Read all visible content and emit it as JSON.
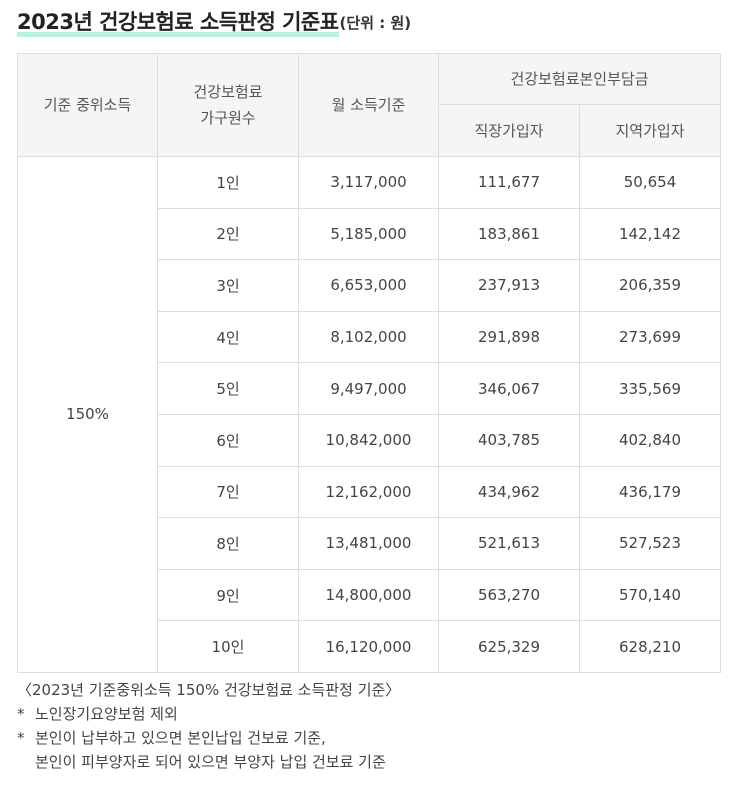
{
  "title": {
    "main": "2023년 건강보험료 소득판정 기준표",
    "unit": "(단위 : 원)"
  },
  "table": {
    "headers": {
      "median_income": "기준 중위소득",
      "household_line1": "건강보험료",
      "household_line2": "가구원수",
      "monthly_income": "월 소득기준",
      "burden_group": "건강보험료본인부담금",
      "employee": "직장가입자",
      "regional": "지역가입자"
    },
    "median_value": "150%",
    "rows": [
      {
        "members": "1인",
        "income": "3,117,000",
        "employee": "111,677",
        "regional": "50,654"
      },
      {
        "members": "2인",
        "income": "5,185,000",
        "employee": "183,861",
        "regional": "142,142"
      },
      {
        "members": "3인",
        "income": "6,653,000",
        "employee": "237,913",
        "regional": "206,359"
      },
      {
        "members": "4인",
        "income": "8,102,000",
        "employee": "291,898",
        "regional": "273,699"
      },
      {
        "members": "5인",
        "income": "9,497,000",
        "employee": "346,067",
        "regional": "335,569"
      },
      {
        "members": "6인",
        "income": "10,842,000",
        "employee": "403,785",
        "regional": "402,840"
      },
      {
        "members": "7인",
        "income": "12,162,000",
        "employee": "434,962",
        "regional": "436,179"
      },
      {
        "members": "8인",
        "income": "13,481,000",
        "employee": "521,613",
        "regional": "527,523"
      },
      {
        "members": "9인",
        "income": "14,800,000",
        "employee": "563,270",
        "regional": "570,140"
      },
      {
        "members": "10인",
        "income": "16,120,000",
        "employee": "625,329",
        "regional": "628,210"
      }
    ]
  },
  "notes": {
    "caption": "〈2023년 기준중위소득 150% 건강보험료 소득판정 기준〉",
    "star": "*",
    "note1": "노인장기요양보험 제외",
    "note2_line1": "본인이 납부하고 있으면 본인납입 건보료 기준,",
    "note2_line2": "본인이 피부양자로 되어 있으면 부양자 납입 건보료 기준"
  }
}
